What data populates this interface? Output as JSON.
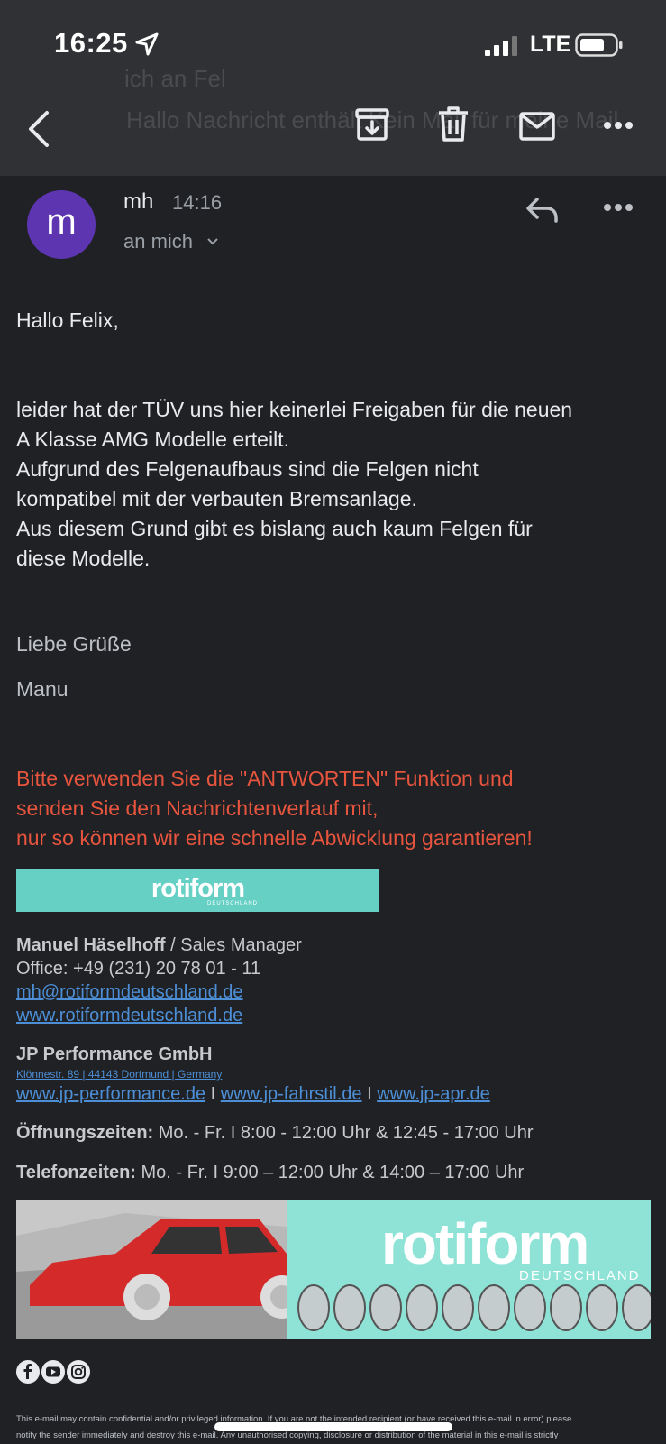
{
  "status_bar": {
    "time": "16:25",
    "network": "LTE"
  },
  "header": {
    "faded_subject": "ich an Fel",
    "faded_preview": "Hallo Nachricht enthält Kein Mail für meine Mail"
  },
  "message": {
    "avatar_letter": "m",
    "sender": "mh",
    "time": "14:16",
    "recipient": "an mich"
  },
  "body": {
    "greeting": "Hallo Felix,",
    "paragraph_lines": [
      "leider hat der TÜV uns hier keinerlei Freigaben für die neuen",
      "A Klasse AMG Modelle erteilt.",
      "Aufgrund des Felgenaufbaus sind die Felgen nicht",
      "kompatibel mit der verbauten Bremsanlage.",
      "Aus diesem Grund gibt es bislang auch kaum Felgen für",
      "diese Modelle."
    ],
    "closing": "Liebe Grüße",
    "name": "Manu",
    "notice_lines": [
      "Bitte verwenden Sie die \"ANTWORTEN\" Funktion und",
      "senden Sie den Nachrichtenverlauf mit,",
      "nur so können wir eine schnelle Abwicklung garantieren!"
    ]
  },
  "signature": {
    "logo_text": "rotiform",
    "logo_subtext": "DEUTSCHLAND",
    "person_name": "Manuel Häselhoff",
    "person_title": " / Sales Manager",
    "office": "Office: +49 (231) 20 78 01 - 11",
    "email": "mh@rotiformdeutschland.de",
    "website": "www.rotiformdeutschland.de",
    "company": "JP Performance GmbH",
    "address": "Klönnestr. 89 | 44143 Dortmund | Germany",
    "links": [
      "www.jp-performance.de",
      "www.jp-fahrstil.de",
      "www.jp-apr.de"
    ],
    "link_separator": "I",
    "hours_label": "Öffnungszeiten:",
    "hours_value": " Mo. - Fr. I 8:00 - 12:00 Uhr & 12:45 - 17:00 Uhr",
    "phone_label": "Telefonzeiten:",
    "phone_value": " Mo. - Fr. I 9:00 – 12:00 Uhr & 14:00 – 17:00 Uhr",
    "banner_logo": "rotiform",
    "banner_sub": "DEUTSCHLAND"
  },
  "disclaimer_lines": [
    "This e-mail may contain confidential and/or privileged information. If you are not the intended recipient (or have received this e-mail in error) please",
    "notify the sender immediately and destroy this e-mail. Any unauthorised copying, disclosure or distribution of the material in this e-mail is strictly"
  ],
  "colors": {
    "avatar": "#5e35b1",
    "notice": "#e8553f",
    "link": "#4d8fd6",
    "brand_teal": "#66d0c5"
  }
}
